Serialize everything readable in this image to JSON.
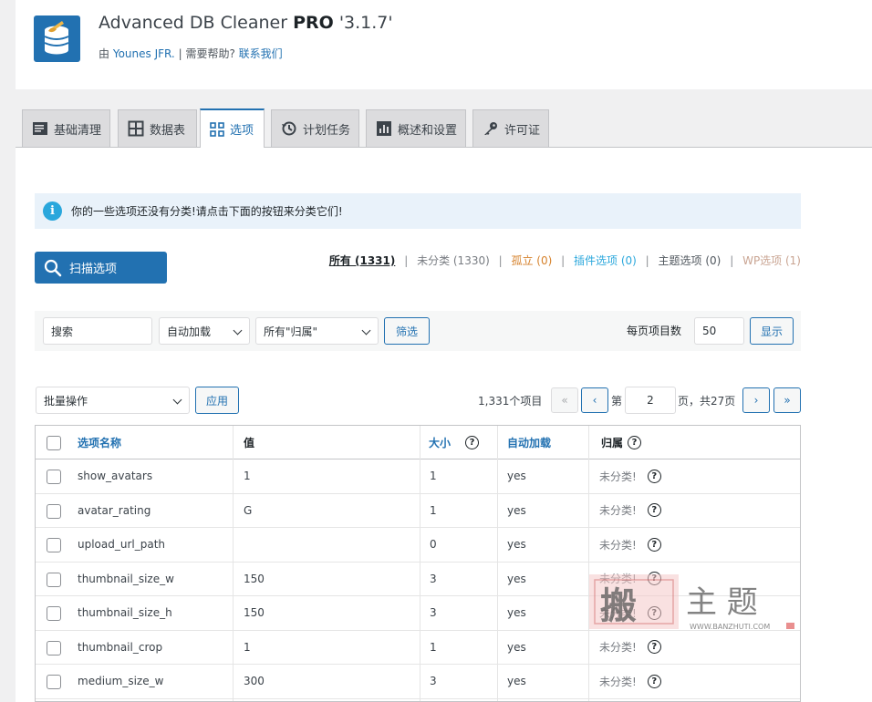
{
  "header": {
    "title_prefix": "Advanced DB Cleaner ",
    "title_bold": "PRO",
    "title_version": " '3.1.7'",
    "by_label": "由",
    "author": "Younes JFR.",
    "sep": "|",
    "help_label": "需要帮助?",
    "contact_link": "联系我们"
  },
  "tabs": [
    {
      "label": "基础清理",
      "icon": "general-cleanup-icon"
    },
    {
      "label": "数据表",
      "icon": "table-grid-icon"
    },
    {
      "label": "选项",
      "icon": "options-grid-icon"
    },
    {
      "label": "计划任务",
      "icon": "history-clock-icon"
    },
    {
      "label": "概述和设置",
      "icon": "overview-chart-icon"
    },
    {
      "label": "许可证",
      "icon": "key-icon"
    }
  ],
  "notice": {
    "text": "你的一些选项还没有分类!请点击下面的按钮来分类它们!"
  },
  "scan_button": "扫描选项",
  "filters": {
    "all": "所有 (1331)",
    "uncategorized": "未分类 (1330)",
    "orphan": "孤立 (0)",
    "plugin": "插件选项 (0)",
    "theme": "主题选项 (0)",
    "wp": "WP选项 (1)",
    "sep": "|"
  },
  "search": {
    "placeholder": "搜索",
    "autoload_select": "自动加载",
    "owner_select": "所有\"归属\"",
    "filter_button": "筛选",
    "per_page_label": "每页项目数",
    "per_page_value": "50",
    "show_button": "显示"
  },
  "bulk": {
    "select": "批量操作",
    "apply": "应用"
  },
  "pagination": {
    "count": "1,331个项目",
    "first": "«",
    "prev": "‹",
    "page_prefix": "第",
    "current_page": "2",
    "page_suffix": "页，共27页",
    "next": "›",
    "last": "»"
  },
  "table": {
    "columns": [
      "选项名称",
      "值",
      "大小",
      "自动加载",
      "归属"
    ],
    "rows": [
      {
        "name": "show_avatars",
        "value": "1",
        "size": "1",
        "autoload": "yes",
        "owner": "未分类!"
      },
      {
        "name": "avatar_rating",
        "value": "G",
        "size": "1",
        "autoload": "yes",
        "owner": "未分类!"
      },
      {
        "name": "upload_url_path",
        "value": "",
        "size": "0",
        "autoload": "yes",
        "owner": "未分类!"
      },
      {
        "name": "thumbnail_size_w",
        "value": "150",
        "size": "3",
        "autoload": "yes",
        "owner": "未分类!"
      },
      {
        "name": "thumbnail_size_h",
        "value": "150",
        "size": "3",
        "autoload": "yes",
        "owner": "未分类!"
      },
      {
        "name": "thumbnail_crop",
        "value": "1",
        "size": "1",
        "autoload": "yes",
        "owner": "未分类!"
      },
      {
        "name": "medium_size_w",
        "value": "300",
        "size": "3",
        "autoload": "yes",
        "owner": "未分类!"
      }
    ]
  },
  "watermark": {
    "text": "主 题",
    "url": "WWW.BANZHUTI.COM"
  }
}
